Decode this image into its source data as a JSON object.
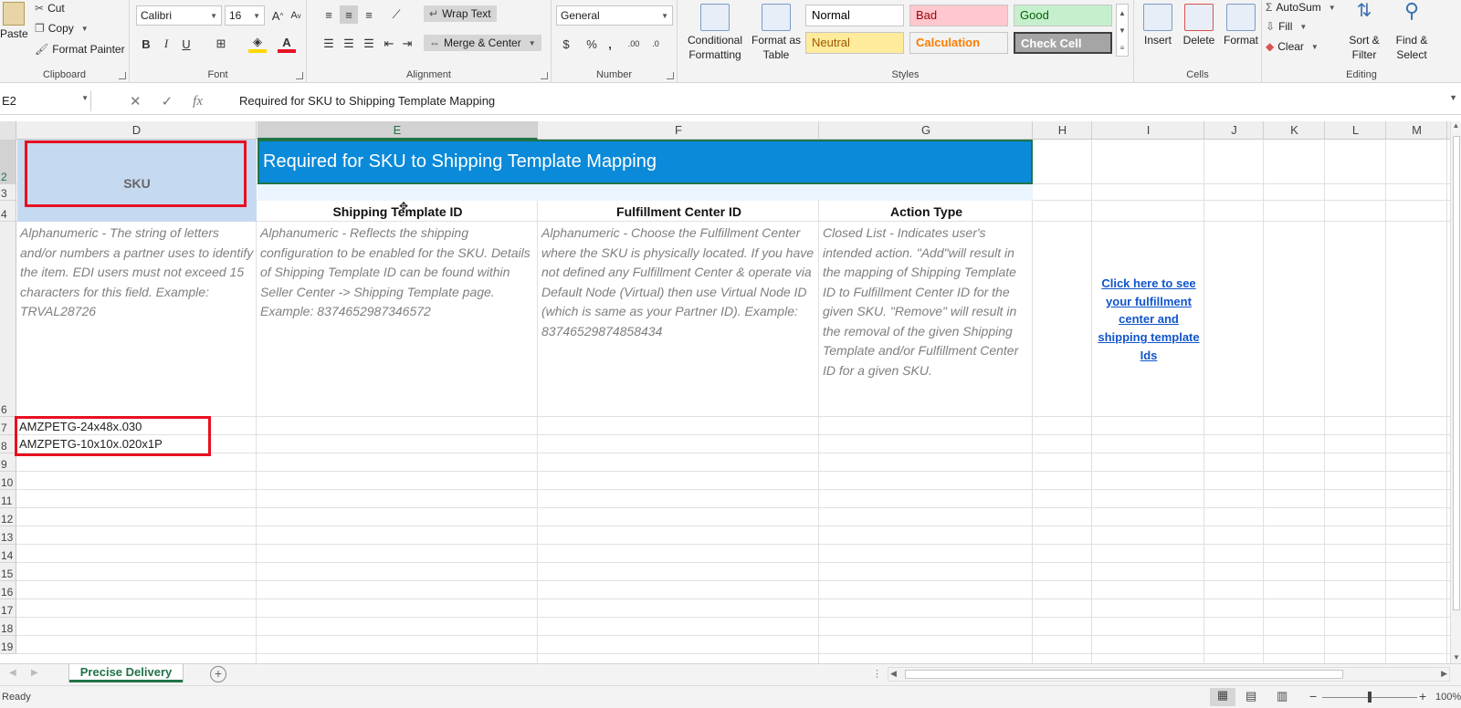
{
  "ribbon": {
    "clipboard": {
      "paste": "Paste",
      "cut": "Cut",
      "copy": "Copy",
      "format_painter": "Format Painter",
      "label": "Clipboard"
    },
    "font": {
      "name": "Calibri",
      "size": "16",
      "grow": "A",
      "shrink": "A",
      "bold": "B",
      "italic": "I",
      "underline": "U",
      "label": "Font",
      "fill_color": "#ffd800",
      "font_color": "#e81123"
    },
    "alignment": {
      "wrap_text": "Wrap Text",
      "merge_center": "Merge & Center",
      "label": "Alignment"
    },
    "number": {
      "format": "General",
      "currency": "$",
      "percent": "%",
      "comma": ",",
      "inc_decimal": ".00",
      "dec_decimal": ".0",
      "label": "Number"
    },
    "styles": {
      "conditional_formatting": [
        "Conditional",
        "Formatting"
      ],
      "format_as_table": [
        "Format as",
        "Table"
      ],
      "cells": [
        {
          "label": "Normal",
          "bg": "#ffffff",
          "fg": "#000000"
        },
        {
          "label": "Bad",
          "bg": "#ffc7ce",
          "fg": "#9c0006"
        },
        {
          "label": "Good",
          "bg": "#c6efce",
          "fg": "#006100"
        },
        {
          "label": "Neutral",
          "bg": "#ffeb9c",
          "fg": "#9c5700"
        },
        {
          "label": "Calculation",
          "bg": "#f2f2f2",
          "fg": "#fa7d00"
        },
        {
          "label": "Check Cell",
          "bg": "#a5a5a5",
          "fg": "#ffffff"
        }
      ],
      "label": "Styles"
    },
    "cells": {
      "insert": "Insert",
      "delete": "Delete",
      "format": "Format",
      "label": "Cells"
    },
    "editing": {
      "autosum": "AutoSum",
      "fill": "Fill",
      "clear": "Clear",
      "sort_filter": [
        "Sort &",
        "Filter"
      ],
      "find_select": [
        "Find &",
        "Select"
      ],
      "label": "Editing"
    }
  },
  "formula_bar": {
    "name_box": "E2",
    "fx": "fx",
    "formula": "Required for SKU to Shipping Template Mapping"
  },
  "grid": {
    "columns": [
      "D",
      "E",
      "F",
      "G",
      "H",
      "I",
      "J",
      "K",
      "L",
      "M"
    ],
    "rows": [
      "2",
      "3",
      "4",
      "6",
      "7",
      "8",
      "9",
      "10",
      "11",
      "12",
      "13",
      "14",
      "15",
      "16",
      "17",
      "18",
      "19"
    ],
    "selected_column": "E",
    "selected_row": "2",
    "sku_header": "SKU",
    "title_banner": "Required for SKU to Shipping Template Mapping",
    "headers": {
      "shipping_template": "Shipping Template ID",
      "fulfillment_center": "Fulfillment Center ID",
      "action_type": "Action Type"
    },
    "descriptions": {
      "sku": "Alphanumeric - The string of letters and/or numbers a partner uses to identify the item. EDI users must not exceed 15 characters for this field. Example: TRVAL28726",
      "shipping_template": "Alphanumeric - Reflects the shipping configuration to be enabled for the SKU. Details of Shipping Template ID can be found within Seller Center -> Shipping Template page. Example: 8374652987346572",
      "fulfillment_center": "Alphanumeric -  Choose the Fulfillment Center where the SKU is physically located. If you have not defined any Fulfillment Center & operate via Default Node (Virtual) then use Virtual Node ID (which is same as your Partner ID). Example: 83746529874858434",
      "action_type": "Closed List - Indicates user's intended action. \"Add\"will result in the mapping of Shipping Template ID to Fulfillment Center ID for the given SKU. \"Remove\" will result in the removal of the given Shipping Template and/or Fulfillment Center ID for a given SKU."
    },
    "link_text": "Click here to see your fulfillment center and shipping template Ids",
    "sku_values": [
      "AMZPETG-24x48x.030",
      "AMZPETG-10x10x.020x1P"
    ],
    "banner_color": "#0a8ad9",
    "sku_header_bg": "#c5d9f1",
    "highlight_color": "#e8101f"
  },
  "sheet_tabs": {
    "active": "Precise Delivery",
    "add": "+"
  },
  "status_bar": {
    "ready": "Ready",
    "zoom": "100%"
  }
}
